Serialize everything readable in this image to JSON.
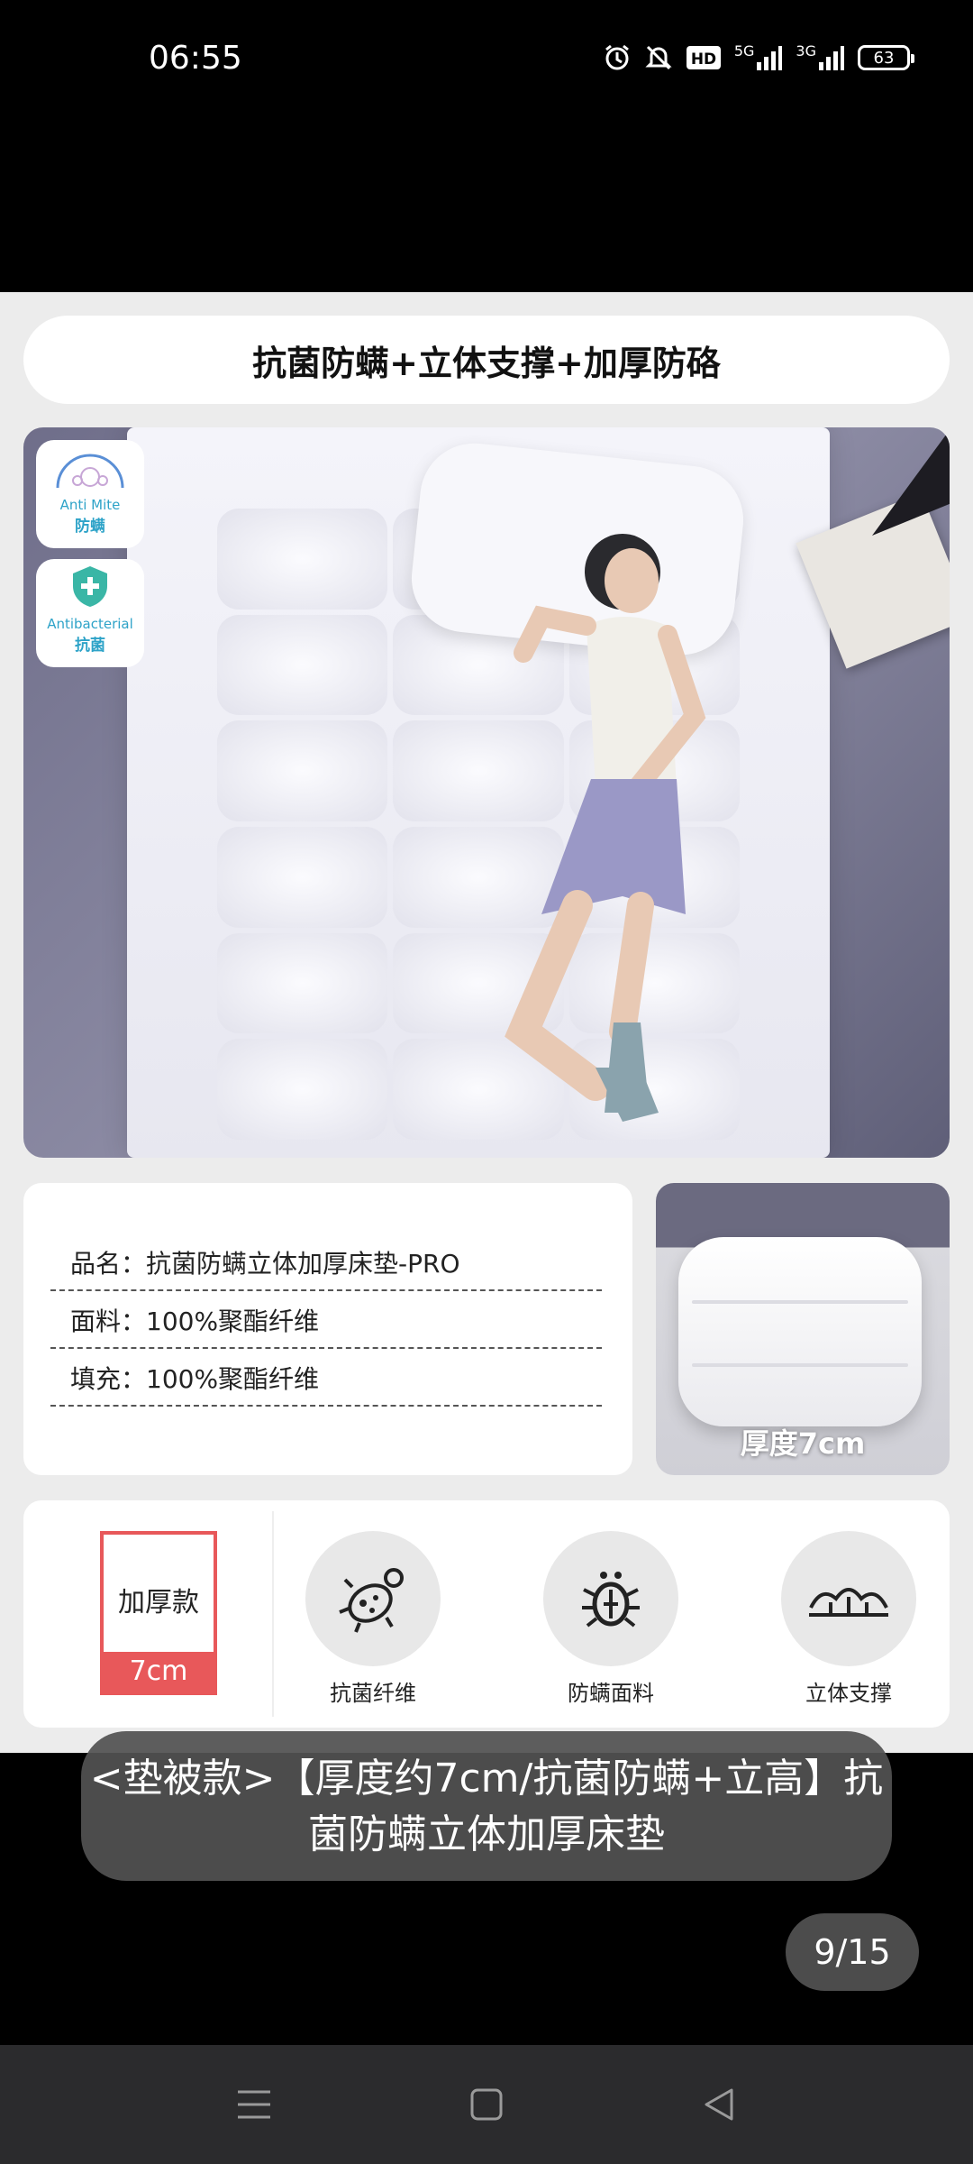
{
  "status_bar": {
    "time": "06:55",
    "icons": [
      "alarm-icon",
      "mute-bell-icon",
      "hd-icon",
      "5g-signal-icon",
      "3g-signal-icon",
      "battery-icon"
    ],
    "hd_label": "HD",
    "net1_label": "5G",
    "net2_label": "3G",
    "battery_level": "63"
  },
  "product": {
    "headline": "抗菌防螨+立体支撑+加厚防硌",
    "badges": [
      {
        "en": "Anti Mite",
        "zh": "防螨",
        "icon": "mite-icon"
      },
      {
        "en": "Antibacterial",
        "zh": "抗菌",
        "icon": "shield-cross-icon"
      }
    ],
    "specs": [
      "品名：抗菌防螨立体加厚床垫-PRO",
      "面料：100%聚酯纤维",
      "填充：100%聚酯纤维"
    ],
    "thickness_caption": "厚度7cm",
    "thick_tag": {
      "top": "加厚款",
      "bottom": "7cm"
    },
    "features": [
      {
        "label": "抗菌纤维",
        "icon": "bacteria-icon"
      },
      {
        "label": "防螨面料",
        "icon": "mite-bug-icon"
      },
      {
        "label": "立体支撑",
        "icon": "support-layers-icon"
      }
    ]
  },
  "caption": "<垫被款>【厚度约7cm/抗菌防螨+立高】抗菌防螨立体加厚床垫",
  "page_counter": "9/15",
  "colors": {
    "accent_red": "#e8585a",
    "badge_blue": "#2ea3c8"
  },
  "nav_bar": {
    "icons": [
      "menu-icon",
      "home-square-icon",
      "back-triangle-icon"
    ]
  }
}
